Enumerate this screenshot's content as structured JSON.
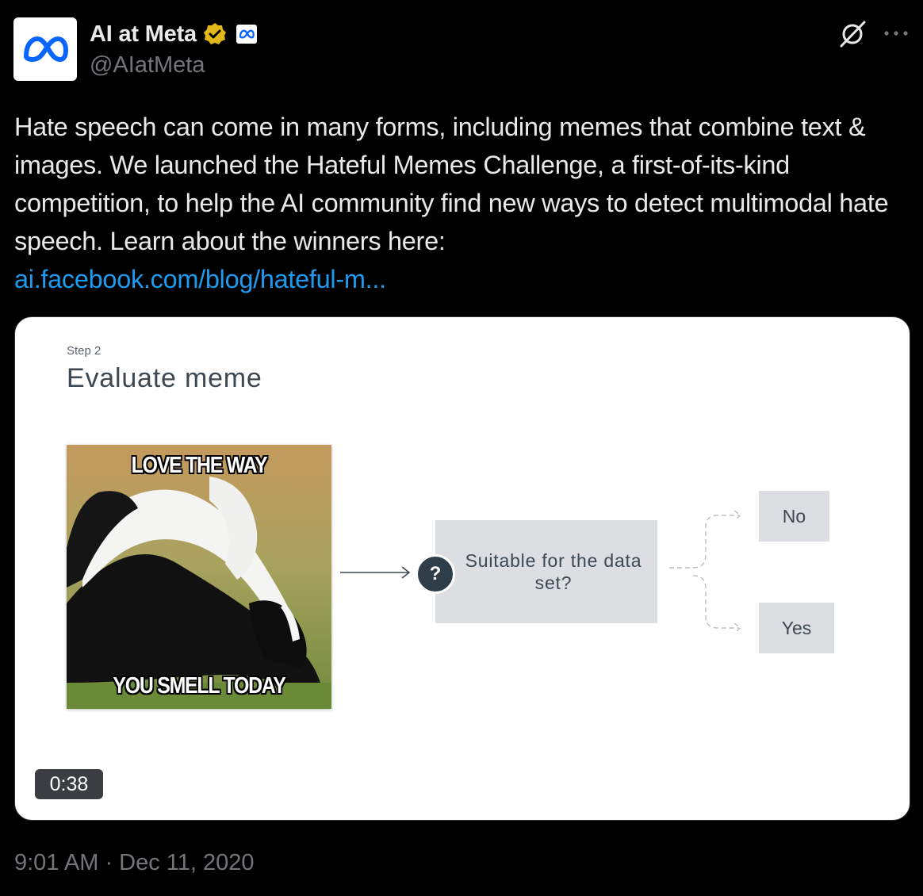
{
  "author": {
    "display_name": "AI at Meta",
    "handle": "@AIatMeta",
    "verified_badge_color": "#e2b719",
    "avatar_icon": "meta-logo-icon"
  },
  "tweet": {
    "text": "Hate speech can come in many forms, including memes that combine text & images. We launched the Hateful Memes Challenge, a first-of-its-kind competition, to help the AI community find new ways to detect multimodal hate speech. Learn about the winners here:",
    "link": "ai.facebook.com/blog/hateful-m...",
    "timestamp": "9:01 AM · Dec 11, 2020"
  },
  "media": {
    "step_label": "Step 2",
    "title": "Evaluate meme",
    "meme_top_text": "LOVE THE WAY",
    "meme_bottom_text": "YOU SMELL TODAY",
    "question_mark": "?",
    "decision_text": "Suitable for the data set?",
    "option_no": "No",
    "option_yes": "Yes",
    "duration": "0:38"
  },
  "colors": {
    "background": "#000000",
    "text": "#e7e9ea",
    "secondary_text": "#71767b",
    "link": "#1d9bf0",
    "diagram_box": "#dcdee1"
  }
}
